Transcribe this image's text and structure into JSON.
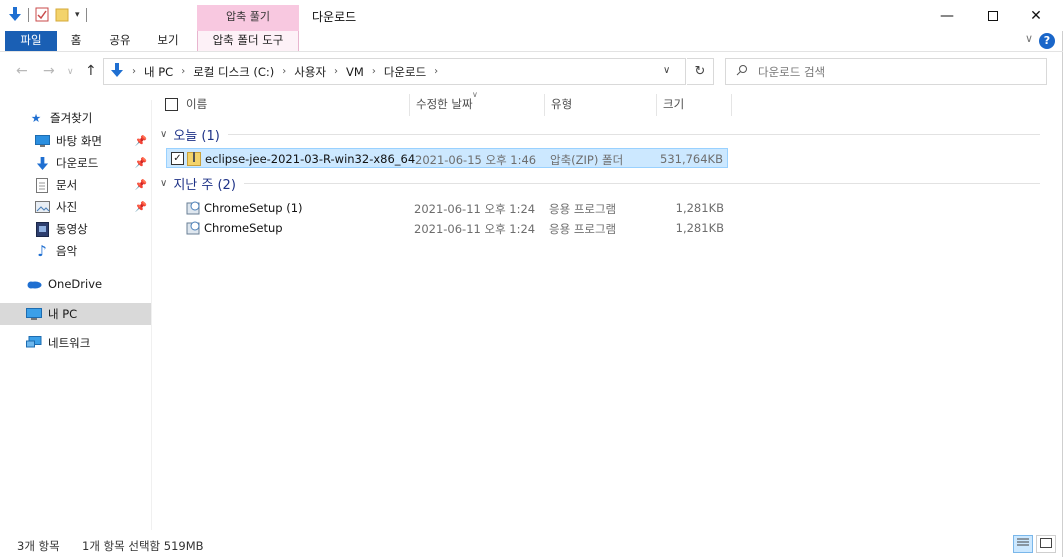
{
  "title": "다운로드",
  "context_tab_header": "압축 풀기",
  "ribbon_tabs": [
    "파일",
    "홈",
    "공유",
    "보기",
    "압축 폴더 도구"
  ],
  "address": {
    "crumbs": [
      "내 PC",
      "로컬 디스크 (C:)",
      "사용자",
      "VM",
      "다운로드"
    ]
  },
  "search": {
    "placeholder": "다운로드 검색"
  },
  "nav": {
    "quick_access": "즐겨찾기",
    "items": [
      {
        "label": "바탕 화면",
        "icon": "desktop-icon",
        "pinned": true
      },
      {
        "label": "다운로드",
        "icon": "download-icon",
        "pinned": true
      },
      {
        "label": "문서",
        "icon": "document-icon",
        "pinned": true
      },
      {
        "label": "사진",
        "icon": "picture-icon",
        "pinned": true
      },
      {
        "label": "동영상",
        "icon": "video-icon",
        "pinned": false
      },
      {
        "label": "음악",
        "icon": "music-icon",
        "pinned": false
      }
    ],
    "onedrive": "OneDrive",
    "this_pc": "내 PC",
    "network": "네트워크"
  },
  "columns": {
    "name": "이름",
    "modified": "수정한 날짜",
    "type": "유형",
    "size": "크기"
  },
  "groups": [
    {
      "label": "오늘 (1)",
      "files": [
        {
          "name": "eclipse-jee-2021-03-R-win32-x86_64",
          "modified": "2021-06-15 오후 1:46",
          "type": "압축(ZIP) 폴더",
          "size": "531,764KB",
          "selected": true
        }
      ]
    },
    {
      "label": "지난 주 (2)",
      "files": [
        {
          "name": "ChromeSetup (1)",
          "modified": "2021-06-11 오후 1:24",
          "type": "응용 프로그램",
          "size": "1,281KB",
          "selected": false
        },
        {
          "name": "ChromeSetup",
          "modified": "2021-06-11 오후 1:24",
          "type": "응용 프로그램",
          "size": "1,281KB",
          "selected": false
        }
      ]
    }
  ],
  "status": {
    "count": "3개 항목",
    "selection": "1개 항목 선택함 519MB"
  },
  "colors": {
    "accent": "#1a5fb4",
    "selected_row": "#cce8ff",
    "context_tab": "#f8c8e0",
    "group_text": "#1e3287"
  }
}
